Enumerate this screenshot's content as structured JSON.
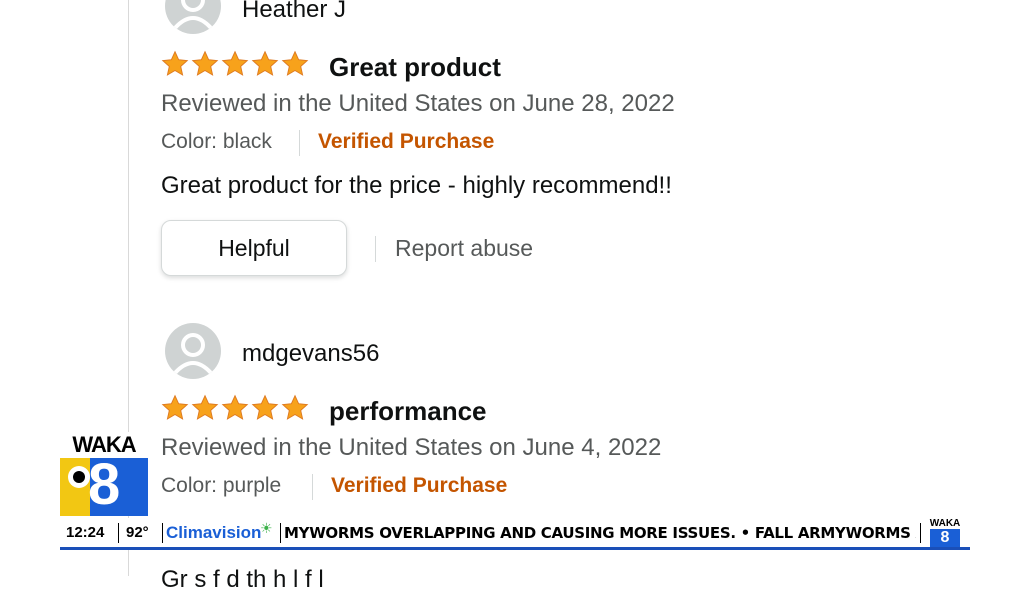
{
  "reviews": [
    {
      "username": "Heather J",
      "rating": 5,
      "title": "Great product",
      "review_meta": "Reviewed in the United States on June 28, 2022",
      "color": "Color: black",
      "verified": "Verified Purchase",
      "body": "Great product for the price - highly recommend!!",
      "helpful_label": "Helpful",
      "report_label": "Report abuse"
    },
    {
      "username": "mdgevans56",
      "rating": 5,
      "title": "performance",
      "review_meta": "Reviewed in the United States on June 4, 2022",
      "color": "Color: purple",
      "verified": "Verified Purchase",
      "body_partial": "Gr      s    f      d  th     h  l  f l"
    }
  ],
  "colors": {
    "star": "#f7a21b",
    "verified": "#c45500",
    "meta": "#565959"
  },
  "broadcast": {
    "station_name": "WAKA",
    "channel": "8",
    "time": "12:24",
    "temperature": "92°",
    "sponsor": "Climavision",
    "ticker_text": "MYWORMS OVERLAPPING AND CAUSING MORE ISSUES.  •  FALL ARMYWORMS ARE PLAGUING",
    "mini_logo_name": "WAKA",
    "mini_logo_channel": "8"
  }
}
